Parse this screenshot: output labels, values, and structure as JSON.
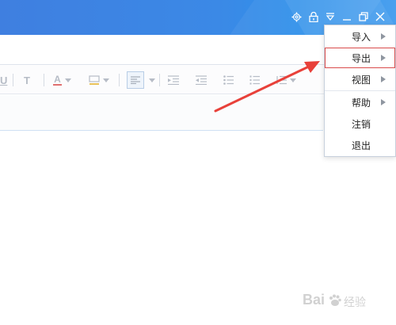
{
  "window": {
    "controls": [
      "settings-icon",
      "lock-icon",
      "menu-dropdown-icon",
      "minimize-icon",
      "restore-icon",
      "close-icon"
    ],
    "accent_color": "#3b89e6"
  },
  "toolbar": {
    "buttons": [
      "underline-icon",
      "text-style-icon",
      "font-color-icon",
      "highlight-color-icon",
      "align-left-icon",
      "indent-increase-icon",
      "indent-decrease-icon",
      "bulleted-list-icon",
      "numbered-list-icon",
      "line-spacing-icon"
    ],
    "underline_label": "U",
    "text_style_label": "T",
    "font_color_label": "A"
  },
  "menu": {
    "items": [
      {
        "label": "导入",
        "has_submenu": true
      },
      {
        "label": "导出",
        "has_submenu": true,
        "highlighted": true
      },
      {
        "label": "视图",
        "has_submenu": true
      },
      {
        "label": "帮助",
        "has_submenu": true
      },
      {
        "label": "注销",
        "has_submenu": false
      },
      {
        "label": "退出",
        "has_submenu": false
      }
    ],
    "highlight_color": "#d94b4b"
  },
  "annotation": {
    "arrow_color": "#e8413a"
  },
  "watermark": {
    "brand": "Bai",
    "sub": "经验"
  }
}
